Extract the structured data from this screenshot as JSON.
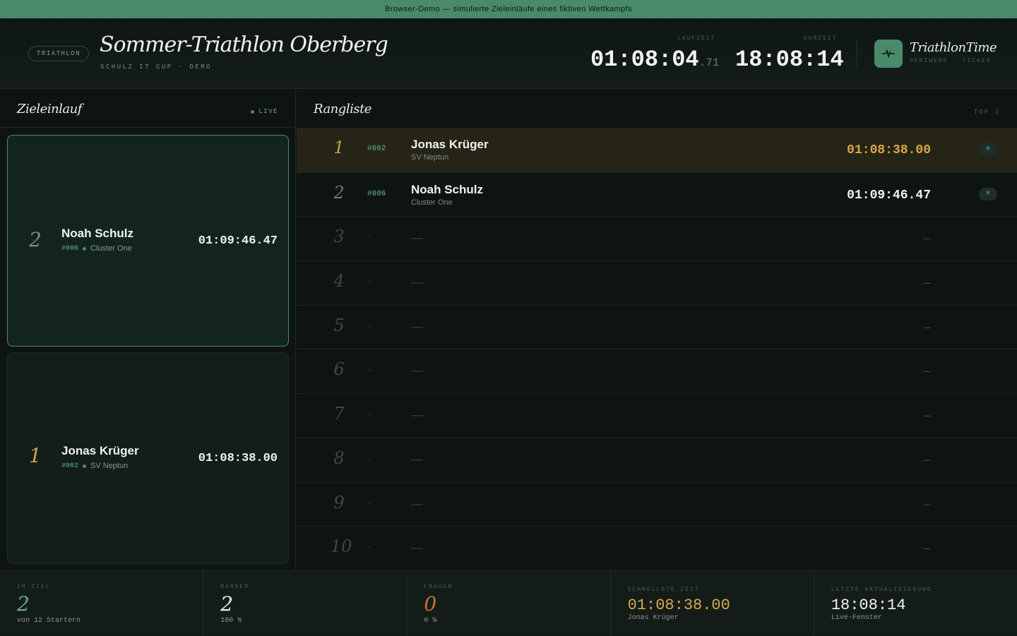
{
  "banner": "Browser-Demo — simulierte Zieleinläufe eines fiktiven Wettkampfs",
  "header": {
    "pill": "TRIATHLON",
    "title": "Sommer-Triathlon Oberberg",
    "subtitle": "SCHULZ IT CUP · DEMO",
    "laufzeit_label": "LAUFZEIT",
    "laufzeit_main": "01:08:04",
    "laufzeit_frac": ".71",
    "uhrzeit_label": "UHRZEIT",
    "uhrzeit": "18:08:14",
    "brand": "TriathlonTime",
    "brand_sub": "HERZWERK · TICKER",
    "logo_icon": "pulse-icon"
  },
  "left_panel": {
    "title": "Zieleinlauf",
    "live": "LIVE",
    "cards": [
      {
        "rank": "2",
        "name": "Noah Schulz",
        "bib": "#006",
        "club": "Cluster One",
        "time": "01:09:46.47",
        "active": true
      },
      {
        "rank": "1",
        "name": "Jonas Krüger",
        "bib": "#002",
        "club": "SV Neptun",
        "time": "01:08:38.00",
        "active": false
      }
    ]
  },
  "right_panel": {
    "title": "Rangliste",
    "top_label": "TOP 2",
    "rows": [
      {
        "rank": "1",
        "bib": "#002",
        "name": "Jonas Krüger",
        "club": "SV Neptun",
        "time": "01:08:38.00",
        "badge": "M"
      },
      {
        "rank": "2",
        "bib": "#006",
        "name": "Noah Schulz",
        "club": "Cluster One",
        "time": "01:09:46.47",
        "badge": "M"
      },
      {
        "rank": "3",
        "bib": "-",
        "name": "—",
        "time": "—"
      },
      {
        "rank": "4",
        "bib": "-",
        "name": "—",
        "time": "—"
      },
      {
        "rank": "5",
        "bib": "-",
        "name": "—",
        "time": "—"
      },
      {
        "rank": "6",
        "bib": "-",
        "name": "—",
        "time": "—"
      },
      {
        "rank": "7",
        "bib": "-",
        "name": "—",
        "time": "—"
      },
      {
        "rank": "8",
        "bib": "-",
        "name": "—",
        "time": "—"
      },
      {
        "rank": "9",
        "bib": "-",
        "name": "—",
        "time": "—"
      },
      {
        "rank": "10",
        "bib": "-",
        "name": "—",
        "time": "—"
      }
    ]
  },
  "footer": {
    "im_ziel_label": "IM ZIEL",
    "im_ziel_value": "2",
    "im_ziel_sub": "von 12 Startern",
    "maenner_label": "MÄNNER",
    "maenner_value": "2",
    "maenner_sub": "100 %",
    "frauen_label": "FRAUEN",
    "frauen_value": "0",
    "frauen_sub": "0 %",
    "schnellste_label": "SCHNELLSTE ZEIT",
    "schnellste_value": "01:08:38.00",
    "schnellste_sub": "Jonas Krüger",
    "update_label": "LETZTE AKTUALISIERUNG",
    "update_value": "18:08:14",
    "update_sub": "Live-Fenster"
  },
  "colors": {
    "accent": "#4a8a6c",
    "gold": "#c9a24e",
    "orange": "#c8703a",
    "background": "#0e1412"
  }
}
